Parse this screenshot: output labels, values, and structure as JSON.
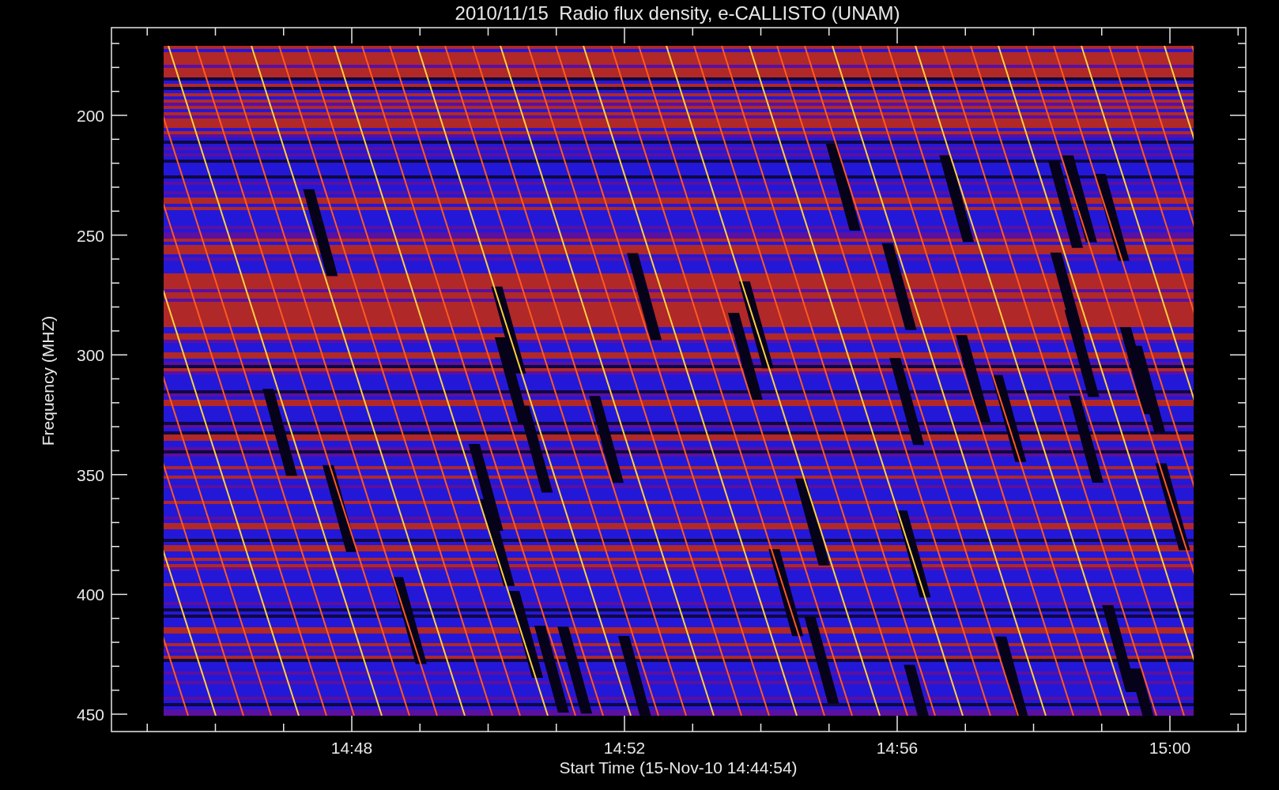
{
  "title": "2010/11/15  Radio flux density, e-CALLISTO (UNAM)",
  "y_axis": {
    "label": "Frequency (MHZ)",
    "ticks": [
      "200",
      "250",
      "300",
      "350",
      "400",
      "450"
    ]
  },
  "x_axis": {
    "label": "Start Time (15-Nov-10 14:44:54)",
    "ticks": [
      "14:48",
      "14:52",
      "14:56",
      "15:00"
    ]
  }
}
